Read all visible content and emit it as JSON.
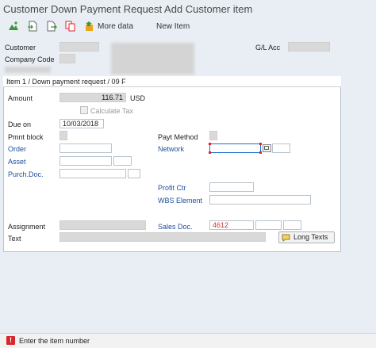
{
  "window": {
    "title": "Customer Down Payment Request Add Customer item"
  },
  "toolbar": {
    "more_data": "More data",
    "new_item": "New Item"
  },
  "header": {
    "customer_label": "Customer",
    "company_code_label": "Company Code",
    "gl_acc_label": "G/L Acc"
  },
  "item": {
    "heading": "Item 1 / Down payment request / 09 F",
    "amount_label": "Amount",
    "amount_value": "116.71",
    "currency": "USD",
    "calculate_tax_label": "Calculate Tax",
    "due_on_label": "Due on",
    "due_on_value": "10/03/2018",
    "pmnt_block_label": "Pmnt block",
    "payt_method_label": "Payt Method",
    "order_label": "Order",
    "network_label": "Network",
    "asset_label": "Asset",
    "purch_doc_label": "Purch.Doc.",
    "profit_ctr_label": "Profit Ctr",
    "wbs_element_label": "WBS Element",
    "assignment_label": "Assignment",
    "sales_doc_label": "Sales Doc.",
    "sales_doc_value": "4612",
    "text_label": "Text",
    "long_texts_button": "Long Texts"
  },
  "status_bar": {
    "type": "error",
    "message": "Enter the item number"
  },
  "colors": {
    "accent_blue": "#1b4f9c",
    "error_red": "#d9262c",
    "focus_red": "#e0242c"
  }
}
